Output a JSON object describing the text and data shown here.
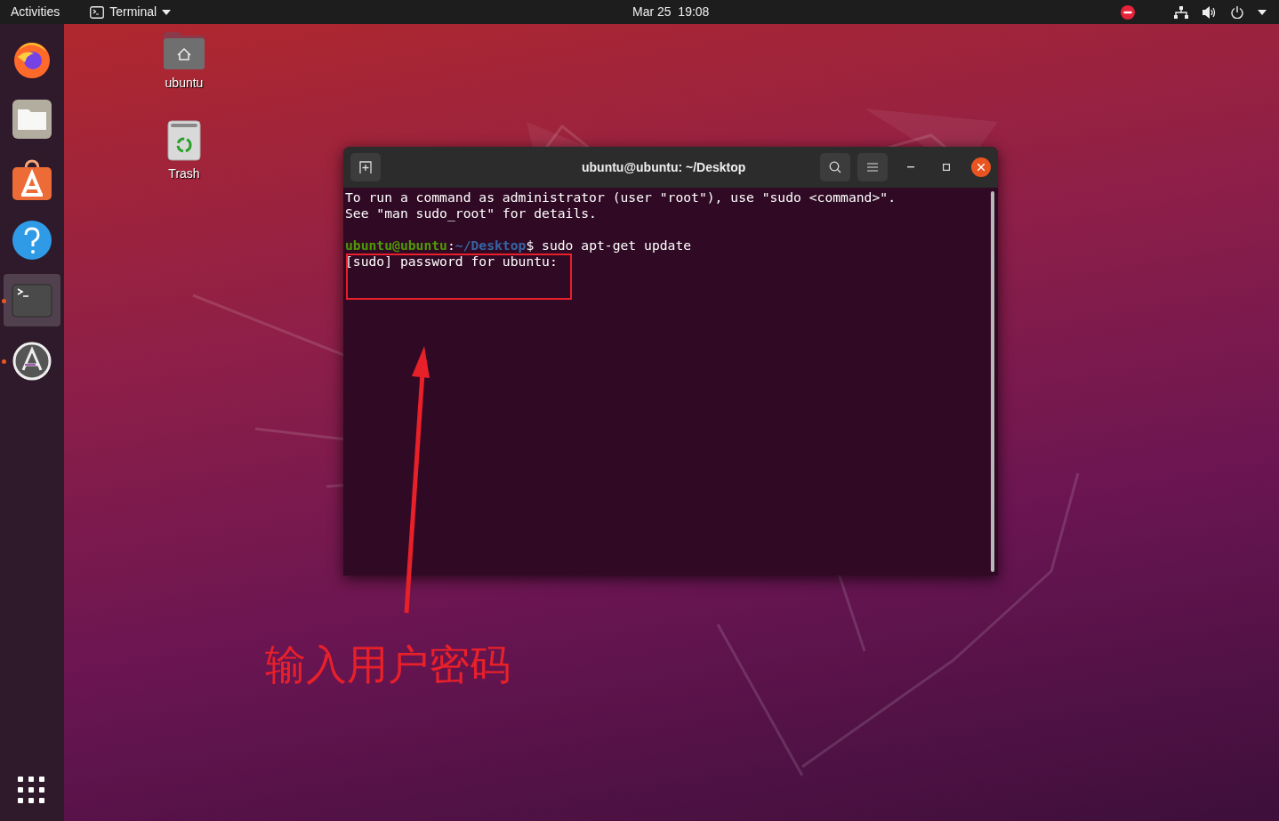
{
  "top_bar": {
    "activities": "Activities",
    "app_menu": "Terminal",
    "clock": "Mar 25  19:08"
  },
  "dock": {
    "items": [
      {
        "kind": "firefox",
        "selected": false,
        "running": false
      },
      {
        "kind": "files",
        "selected": false,
        "running": false
      },
      {
        "kind": "software",
        "selected": false,
        "running": false
      },
      {
        "kind": "help",
        "selected": false,
        "running": false
      },
      {
        "kind": "terminal",
        "selected": true,
        "running": true
      },
      {
        "kind": "updater",
        "selected": false,
        "running": true
      }
    ]
  },
  "desktop_icons": [
    {
      "kind": "home",
      "label": "ubuntu"
    },
    {
      "kind": "trash",
      "label": "Trash"
    }
  ],
  "terminal": {
    "title": "ubuntu@ubuntu: ~/Desktop",
    "lines": [
      {
        "kind": "output",
        "text": "To run a command as administrator (user \"root\"), use \"sudo <command>\"."
      },
      {
        "kind": "output",
        "text": "See \"man sudo_root\" for details."
      },
      {
        "kind": "blank"
      },
      {
        "kind": "prompt",
        "segments": [
          {
            "kind": "user",
            "text": "ubuntu@ubuntu"
          },
          {
            "kind": "plain",
            "text": ":"
          },
          {
            "kind": "path",
            "text": "~/Desktop"
          },
          {
            "kind": "plain",
            "text": "$ sudo apt-get update"
          }
        ]
      },
      {
        "kind": "output",
        "text": "[sudo] password for ubuntu:"
      }
    ]
  },
  "annotation": {
    "text": "输入用户密码"
  }
}
